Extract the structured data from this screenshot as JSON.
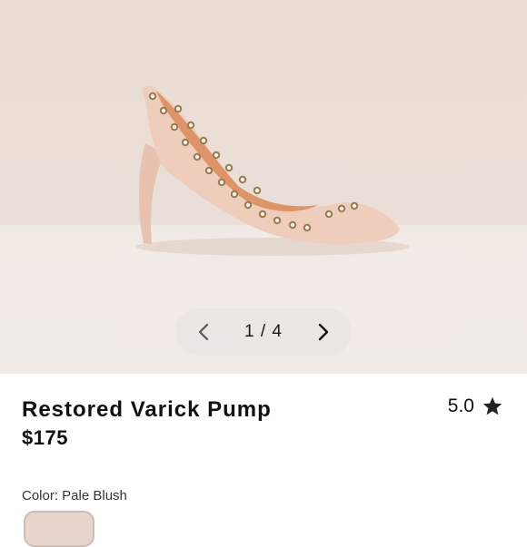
{
  "gallery": {
    "counter": "1 / 4",
    "prev_icon": "chevron-left-icon",
    "next_icon": "chevron-right-icon"
  },
  "product": {
    "title": "Restored Varick Pump",
    "price": "$175",
    "rating": "5.0",
    "rating_icon": "star-icon",
    "color_label": "Color: Pale Blush",
    "swatch_color": "#e8d6cc"
  },
  "colors": {
    "shoe": "#ecc9b9",
    "grommet": "#9a7b4f",
    "lining": "#c8662a"
  }
}
